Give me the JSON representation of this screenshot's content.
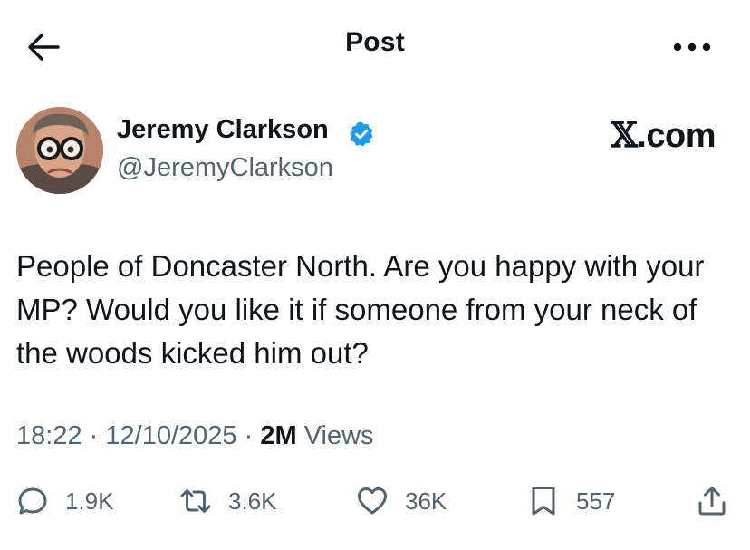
{
  "header": {
    "title": "Post",
    "back_icon": "arrow-left-icon",
    "more_icon": "more-horizontal-icon"
  },
  "author": {
    "name": "Jeremy Clarkson",
    "handle": "@JeremyClarkson",
    "verified": true,
    "verified_color": "#1d9bf0"
  },
  "brand": {
    "glyph": "𝕏",
    "text": ".com"
  },
  "post": {
    "text": "People of Doncaster North. Are you happy with your MP? Would you like it if someone from your neck of the woods kicked him out?"
  },
  "meta": {
    "time": "18:22",
    "separator": "·",
    "date": "12/10/2025",
    "views_count": "2M",
    "views_label": "Views"
  },
  "actions": {
    "replies": "1.9K",
    "reposts": "3.6K",
    "likes": "36K",
    "bookmarks": "557",
    "icons": [
      "reply-icon",
      "repost-icon",
      "like-icon",
      "bookmark-icon",
      "share-icon"
    ]
  },
  "colors": {
    "text": "#0f1419",
    "secondary": "#536471",
    "accent": "#1d9bf0"
  }
}
